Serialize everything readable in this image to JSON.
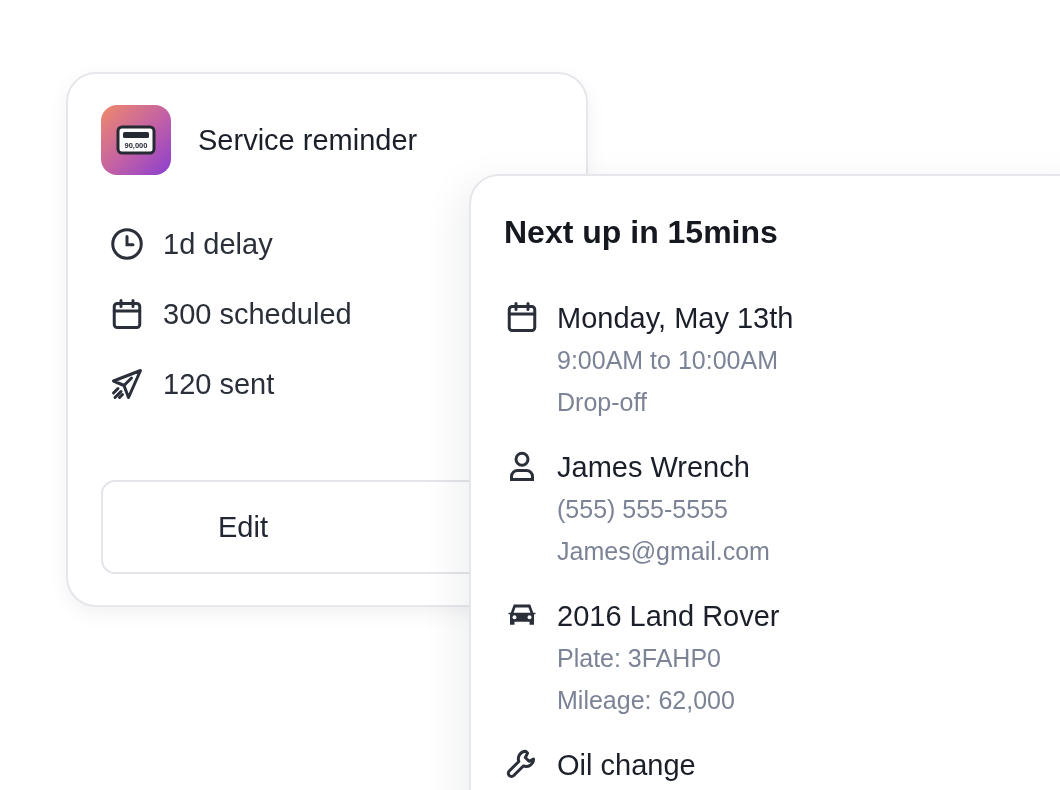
{
  "reminder": {
    "title": "Service reminder",
    "logo_text": "90,000",
    "stats": [
      {
        "kind": "clock",
        "text": "1d delay"
      },
      {
        "kind": "calendar",
        "text": "300 scheduled"
      },
      {
        "kind": "send",
        "text": "120 sent"
      }
    ],
    "button": "Edit"
  },
  "next_up": {
    "title": "Next up in 15mins",
    "sections": [
      {
        "kind": "calendar",
        "heading": "Monday, May 13th",
        "lines": [
          "9:00AM to 10:00AM",
          "Drop-off"
        ]
      },
      {
        "kind": "person",
        "heading": "James Wrench",
        "lines": [
          "(555) 555-5555",
          "James@gmail.com"
        ]
      },
      {
        "kind": "car",
        "heading": "2016 Land Rover",
        "lines": [
          "Plate: 3FAHP0",
          "Mileage: 62,000"
        ]
      },
      {
        "kind": "wrench",
        "heading": "Oil change"
      }
    ]
  }
}
